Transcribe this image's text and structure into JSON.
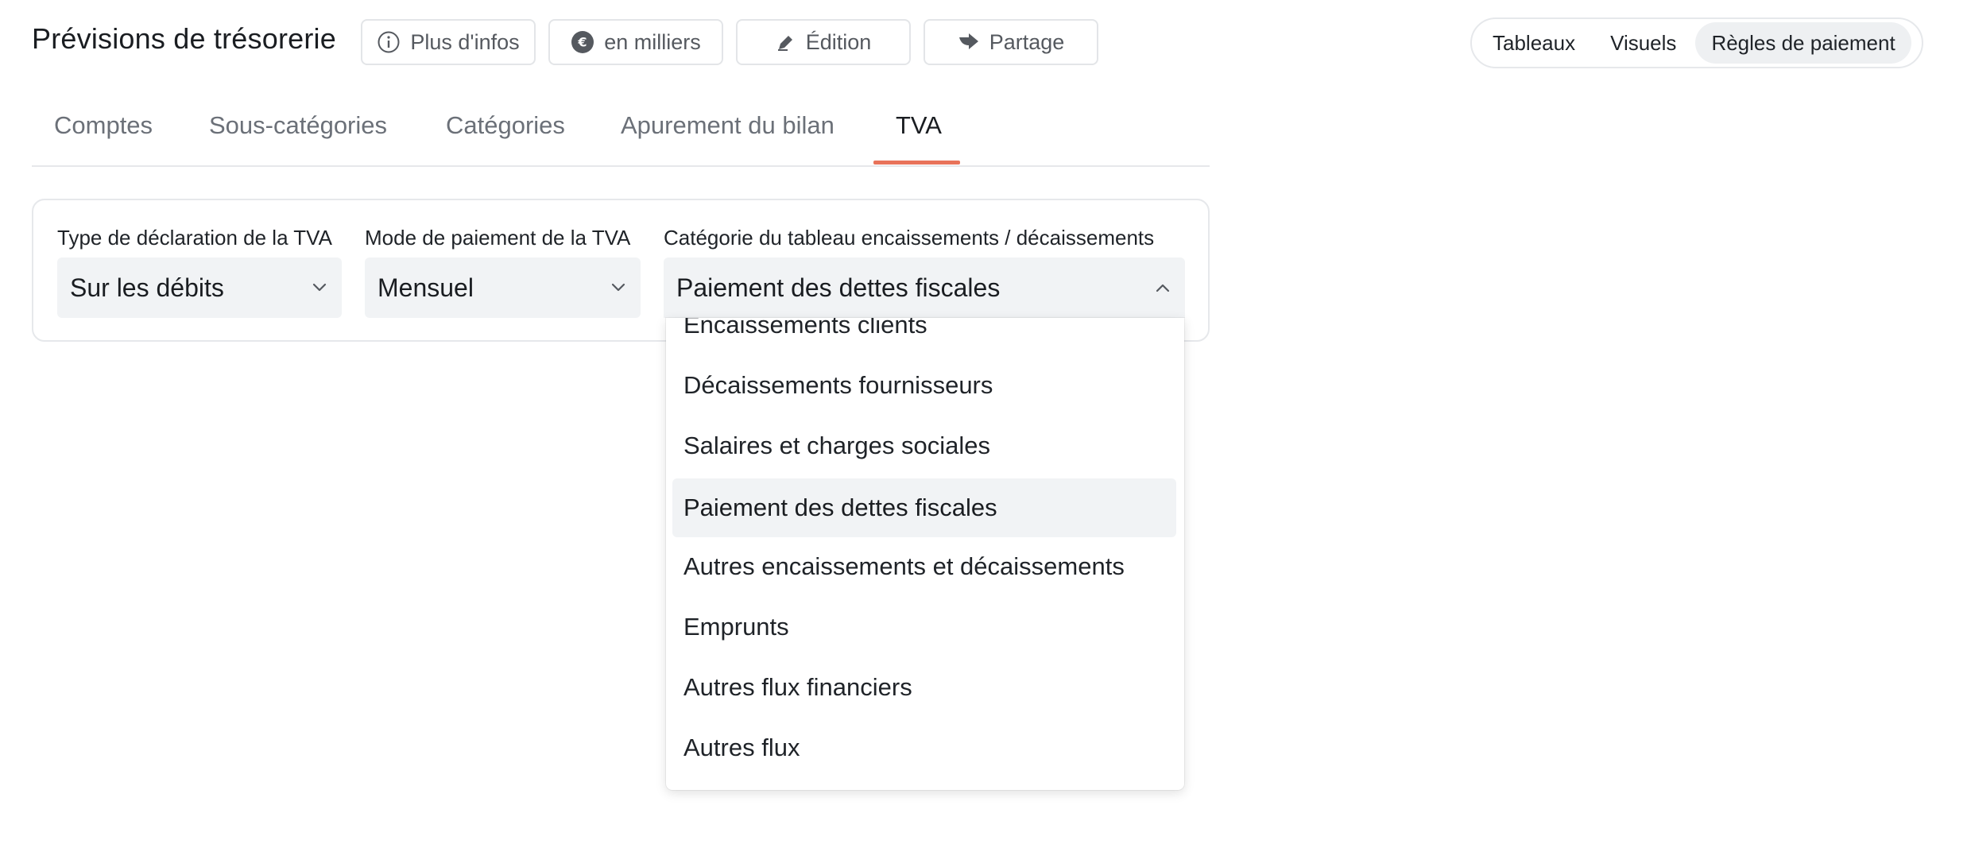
{
  "header": {
    "title": "Prévisions de trésorerie",
    "buttons": {
      "info": "Plus d'infos",
      "units": "en milliers",
      "edit": "Édition",
      "share": "Partage"
    },
    "segmented": {
      "options": [
        "Tableaux",
        "Visuels",
        "Règles de paiement"
      ],
      "active": "Règles de paiement"
    }
  },
  "tabs": {
    "items": [
      "Comptes",
      "Sous-catégories",
      "Catégories",
      "Apurement du bilan",
      "TVA"
    ],
    "active": "TVA"
  },
  "form": {
    "declaration": {
      "label": "Type de déclaration de la TVA",
      "value": "Sur les débits"
    },
    "payment_mode": {
      "label": "Mode de paiement de la TVA",
      "value": "Mensuel"
    },
    "category": {
      "label": "Catégorie du tableau encaissements / décaissements",
      "value": "Paiement des dettes fiscales"
    }
  },
  "dropdown": {
    "options": [
      "Encaissements clients",
      "Décaissements fournisseurs",
      "Salaires et charges sociales",
      "Paiement des dettes fiscales",
      "Autres encaissements et décaissements",
      "Emprunts",
      "Autres flux financiers",
      "Autres flux"
    ],
    "selected": "Paiement des dettes fiscales"
  },
  "colors": {
    "accent": "#e8735a",
    "field_bg": "#f1f3f5",
    "border": "#e6e8eb"
  }
}
